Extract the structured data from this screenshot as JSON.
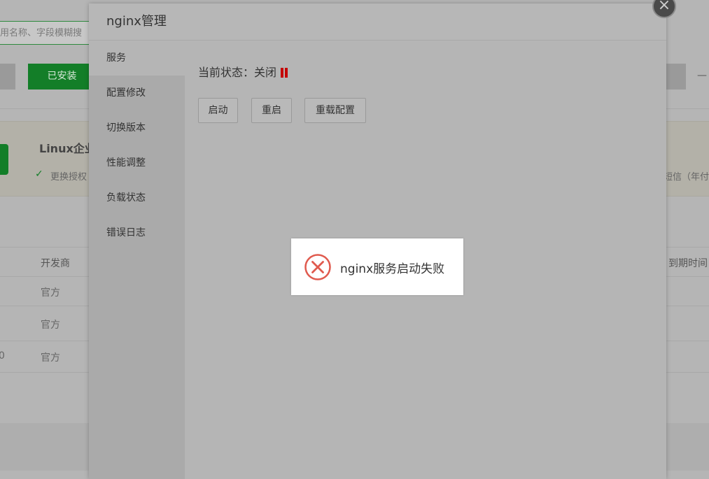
{
  "background": {
    "search_placeholder": "用名称、字段模糊搜",
    "installed_tab": "已安装",
    "right_dash": "—",
    "banner": {
      "title": "Linux企业",
      "check_text": "更换授权",
      "right_text": "短信（年付"
    },
    "table": {
      "columns": [
        "开发商",
        "到期时间"
      ],
      "rows": [
        {
          "prefix": "",
          "developer": "官方",
          "expiry": "-"
        },
        {
          "prefix": "",
          "developer": "官方",
          "expiry": "-"
        },
        {
          "prefix": "0",
          "developer": "官方",
          "expiry": "-"
        }
      ]
    }
  },
  "modal": {
    "title": "nginx管理",
    "close_symbol": "×",
    "sidebar": [
      "服务",
      "配置修改",
      "切换版本",
      "性能调整",
      "负载状态",
      "错误日志"
    ],
    "active_index": 0,
    "status_label": "当前状态：",
    "status_value": "关闭",
    "buttons": {
      "start": "启动",
      "restart": "重启",
      "reload": "重载配置"
    }
  },
  "toast": {
    "message": "nginx服务启动失败",
    "icon": "error-circle-x-icon",
    "icon_color": "#e05a4e"
  },
  "colors": {
    "brand_green": "#137e28",
    "status_red": "#c40000"
  }
}
